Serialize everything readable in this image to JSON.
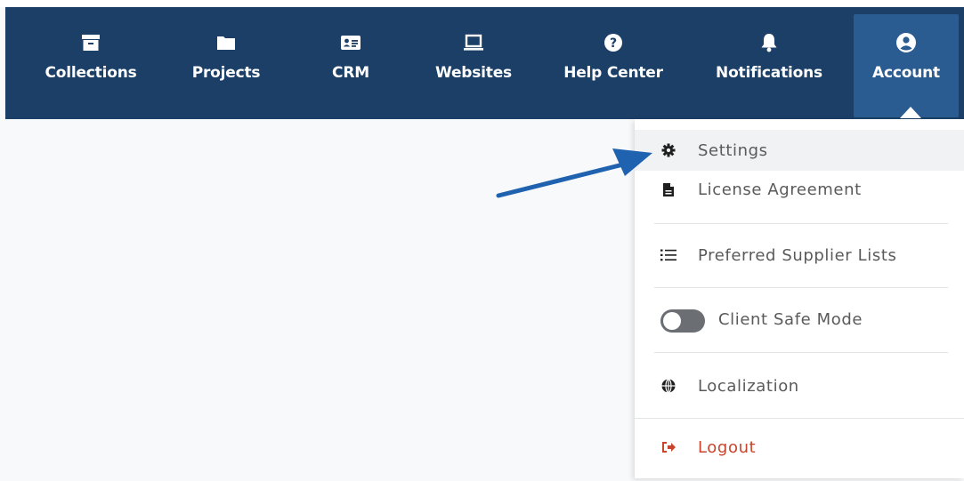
{
  "nav": {
    "items": [
      {
        "label": "Collections",
        "icon": "archive-icon"
      },
      {
        "label": "Projects",
        "icon": "folder-icon"
      },
      {
        "label": "CRM",
        "icon": "contact-card-icon"
      },
      {
        "label": "Websites",
        "icon": "laptop-icon"
      },
      {
        "label": "Help Center",
        "icon": "question-circle-icon"
      },
      {
        "label": "Notifications",
        "icon": "bell-icon"
      },
      {
        "label": "Account",
        "icon": "user-circle-icon",
        "active": true
      }
    ]
  },
  "account_menu": {
    "settings": "Settings",
    "license": "License Agreement",
    "supplier_lists": "Preferred Supplier Lists",
    "client_safe_mode": "Client Safe Mode",
    "client_safe_mode_on": false,
    "localization": "Localization",
    "logout": "Logout"
  },
  "colors": {
    "navbar": "#1b3f66",
    "active_tab": "#2b5c91",
    "annotation_arrow": "#1f63b0",
    "logout": "#c8452d"
  }
}
